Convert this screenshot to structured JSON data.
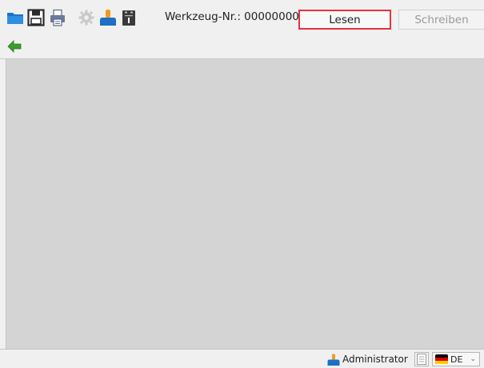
{
  "toolbar": {
    "icons": [
      "open-folder-icon",
      "save-icon",
      "print-icon",
      "settings-icon",
      "user-icon",
      "device-icon"
    ],
    "tool_number_label": "Werkzeug-Nr.: 00000000",
    "read_label": "Lesen",
    "write_label": "Schreiben"
  },
  "nav": {
    "back_icon": "arrow-left-icon"
  },
  "statusbar": {
    "user_label": "Administrator",
    "language": "DE",
    "language_flag": "germany-flag-icon"
  },
  "colors": {
    "highlight_border": "#e8313f",
    "content_background": "#d4d4d4",
    "back_arrow": "#3a9c2c",
    "folder": "#1e7fd0"
  }
}
